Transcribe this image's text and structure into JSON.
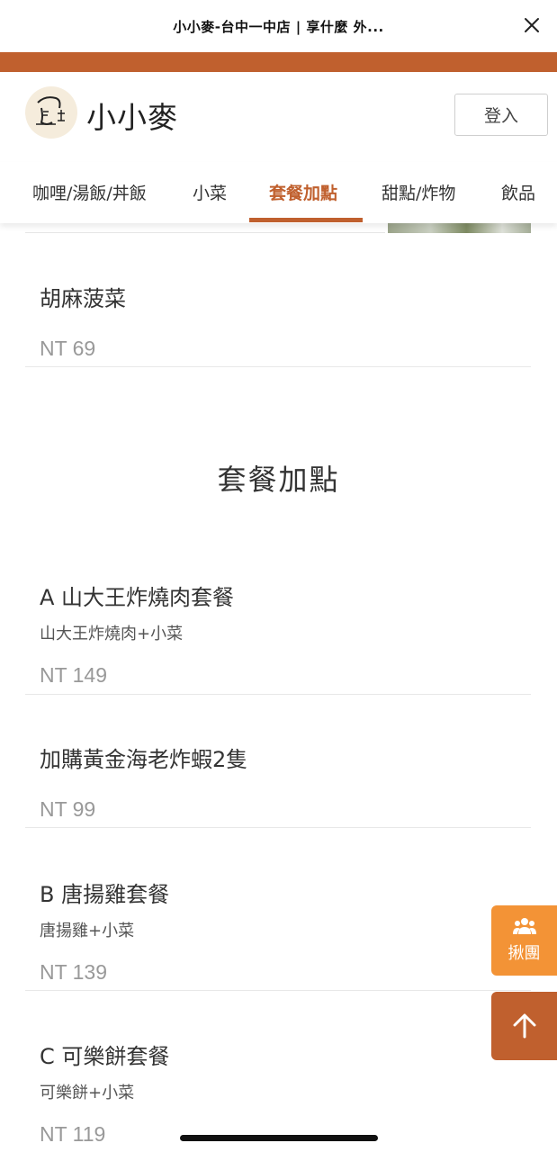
{
  "topbar": {
    "title": "小小麥-台中一中店 | 享什麼 外..."
  },
  "header": {
    "brand": "小小麥",
    "login_label": "登入"
  },
  "tabs": [
    {
      "label": "咖哩/湯飯/丼飯"
    },
    {
      "label": "小菜"
    },
    {
      "label": "套餐加點",
      "active": true
    },
    {
      "label": "甜點/炸物"
    },
    {
      "label": "飲品"
    }
  ],
  "menu": {
    "prev_item": {
      "name": "胡麻菠菜",
      "price": "NT 69"
    },
    "section_title": "套餐加點",
    "items": [
      {
        "name": "A 山大王炸燒肉套餐",
        "desc": "山大王炸燒肉+小菜",
        "price": "NT 149"
      },
      {
        "name": "加購黃金海老炸蝦2隻",
        "desc": "",
        "price": "NT 99"
      },
      {
        "name": "B 唐揚雞套餐",
        "desc": "唐揚雞+小菜",
        "price": "NT 139"
      },
      {
        "name": "C 可樂餅套餐",
        "desc": "可樂餅+小菜",
        "price": "NT 119"
      }
    ]
  },
  "floating": {
    "group_label": "揪團"
  },
  "colors": {
    "accent": "#c0602e",
    "group": "#f39336"
  }
}
